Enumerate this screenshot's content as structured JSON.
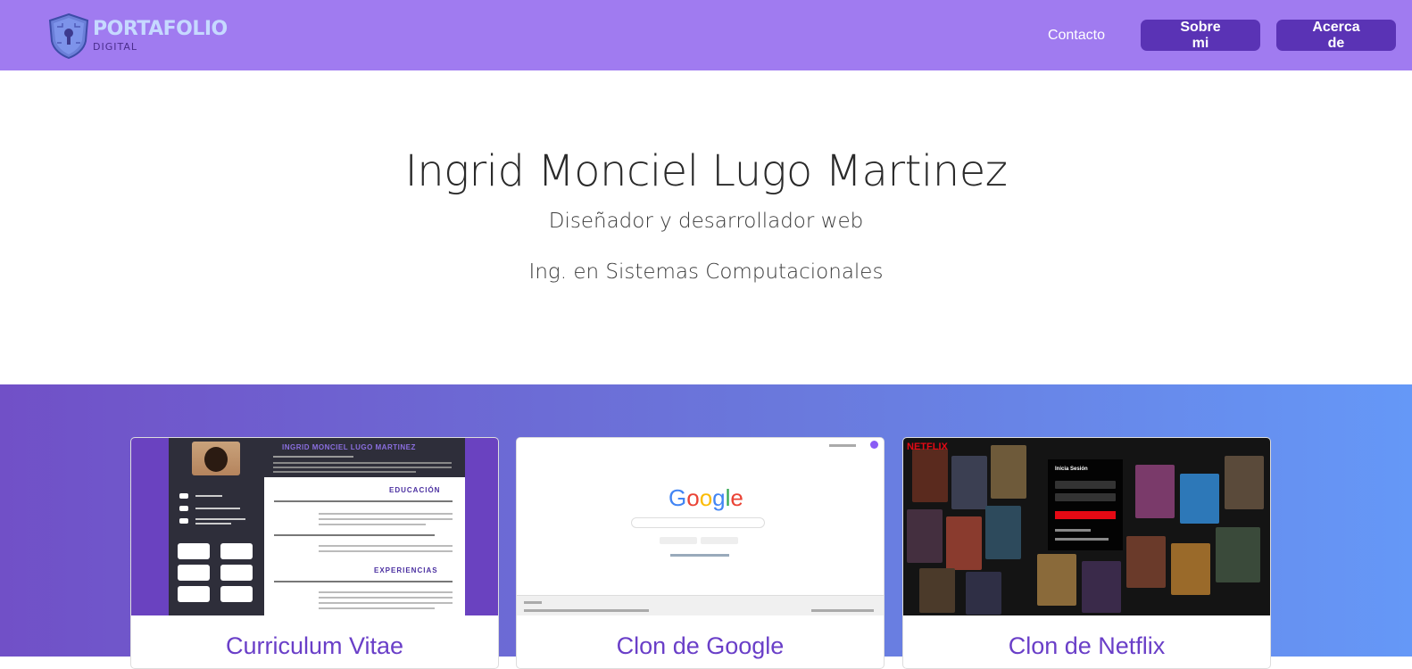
{
  "nav": {
    "brand_title": "PORTAFOLIO",
    "brand_sub": "DIGITAL",
    "contact": "Contacto",
    "about_me": "Sobre mi",
    "about": "Acerca de"
  },
  "hero": {
    "name": "Ingrid Monciel Lugo Martinez",
    "role": "Diseñador y desarrollador web",
    "degree": "Ing. en Sistemas Computacionales"
  },
  "projects": [
    {
      "title": "Curriculum Vitae",
      "thumb_name": "INGRID MONCIEL LUGO MARTINEZ",
      "sections": [
        "EDUCACIÓN",
        "EXPERIENCIAS"
      ]
    },
    {
      "title": "Clon de Google",
      "logo": "Google"
    },
    {
      "title": "Clon de Netflix",
      "logo": "NETFLIX",
      "login_title": "Inicia Sesión"
    }
  ],
  "colors": {
    "navbar": "#a07bf0",
    "button": "#5a33b5",
    "card_title": "#6a3fc8",
    "gradient_start": "#7150c7",
    "gradient_end": "#6598f7"
  }
}
